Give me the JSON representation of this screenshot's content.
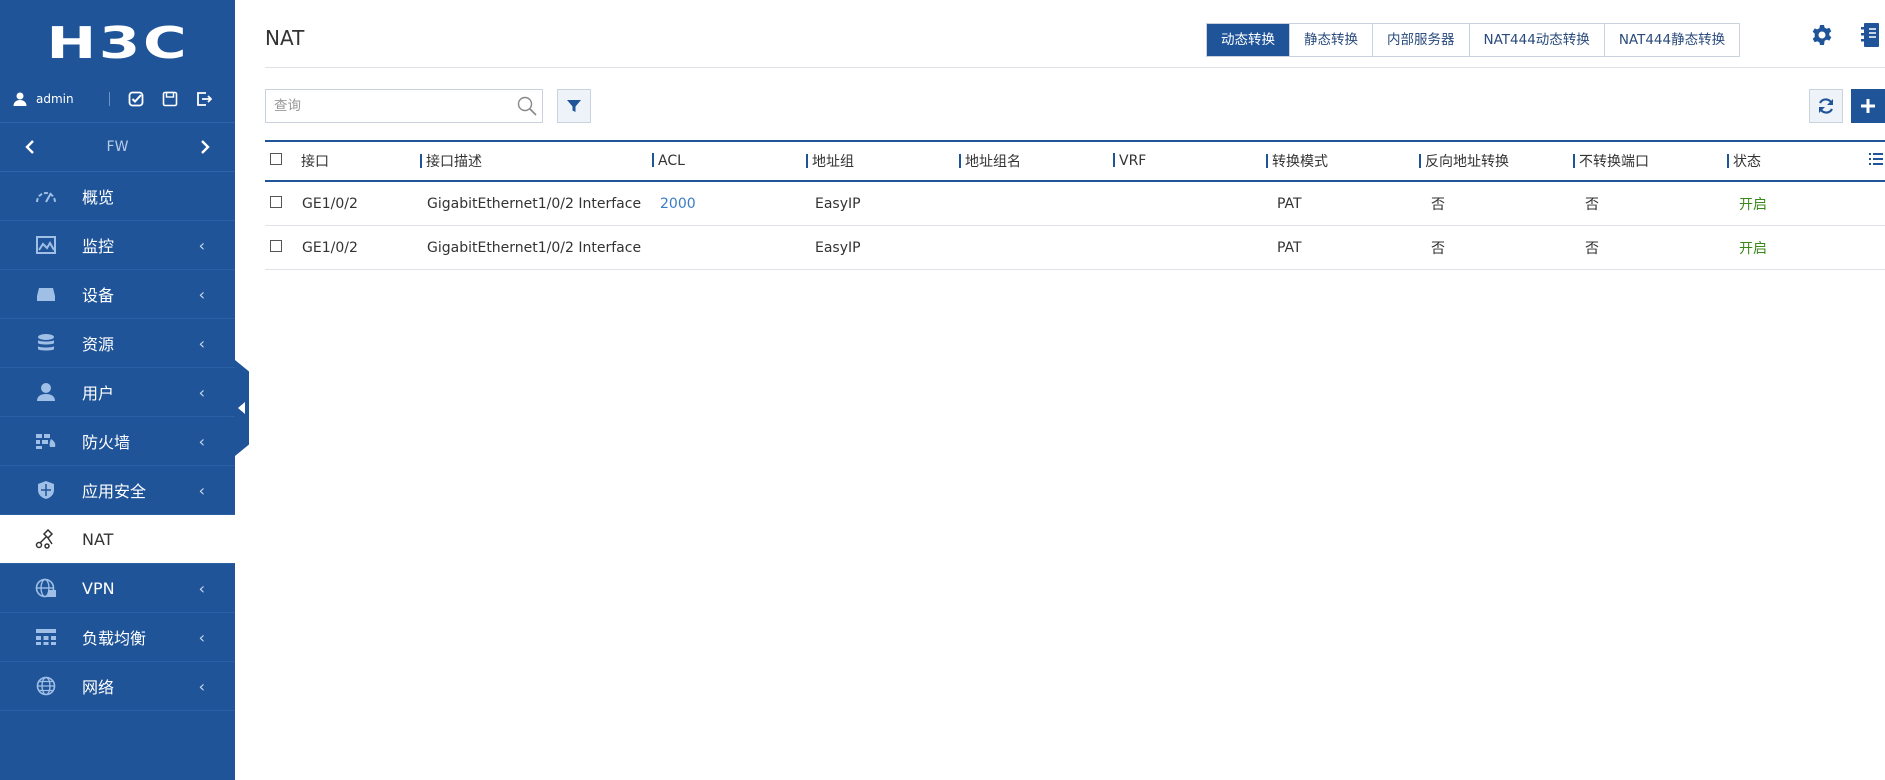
{
  "brand": {
    "logo_text": "H3C"
  },
  "user": {
    "name": "admin"
  },
  "device": {
    "name": "FW"
  },
  "sidebar": {
    "items": [
      {
        "label": "概览",
        "icon": "gauge-icon",
        "has_arrow": false
      },
      {
        "label": "监控",
        "icon": "chart-icon",
        "has_arrow": true
      },
      {
        "label": "设备",
        "icon": "device-icon",
        "has_arrow": true
      },
      {
        "label": "资源",
        "icon": "database-icon",
        "has_arrow": true
      },
      {
        "label": "用户",
        "icon": "user-icon",
        "has_arrow": true
      },
      {
        "label": "防火墙",
        "icon": "firewall-icon",
        "has_arrow": true
      },
      {
        "label": "应用安全",
        "icon": "shield-icon",
        "has_arrow": true
      },
      {
        "label": "NAT",
        "icon": "nat-icon",
        "has_arrow": false,
        "active": true
      },
      {
        "label": "VPN",
        "icon": "globe-lock-icon",
        "has_arrow": true
      },
      {
        "label": "负载均衡",
        "icon": "load-balance-icon",
        "has_arrow": true
      },
      {
        "label": "网络",
        "icon": "network-globe-icon",
        "has_arrow": true
      }
    ],
    "arrow_glyph": "‹"
  },
  "header": {
    "title": "NAT",
    "tabs": [
      {
        "label": "动态转换",
        "active": true
      },
      {
        "label": "静态转换"
      },
      {
        "label": "内部服务器"
      },
      {
        "label": "NAT444动态转换"
      },
      {
        "label": "NAT444静态转换"
      }
    ]
  },
  "search": {
    "placeholder": "查询",
    "value": ""
  },
  "table": {
    "columns": [
      "接口",
      "接口描述",
      "ACL",
      "地址组",
      "地址组名",
      "VRF",
      "转换模式",
      "反向地址转换",
      "不转换端口",
      "状态"
    ],
    "rows": [
      {
        "interface": "GE1/0/2",
        "description": "GigabitEthernet1/0/2 Interface",
        "acl": "2000",
        "address_group": "EasyIP",
        "address_group_name": "",
        "vrf": "",
        "mode": "PAT",
        "reverse": "否",
        "no_port": "否",
        "status": "开启"
      },
      {
        "interface": "GE1/0/2",
        "description": "GigabitEthernet1/0/2 Interface",
        "acl": "",
        "address_group": "EasyIP",
        "address_group_name": "",
        "vrf": "",
        "mode": "PAT",
        "reverse": "否",
        "no_port": "否",
        "status": "开启"
      }
    ]
  },
  "colors": {
    "brand": "#1f5499",
    "status_on": "#3a8a1a",
    "link": "#3a7dc4"
  }
}
